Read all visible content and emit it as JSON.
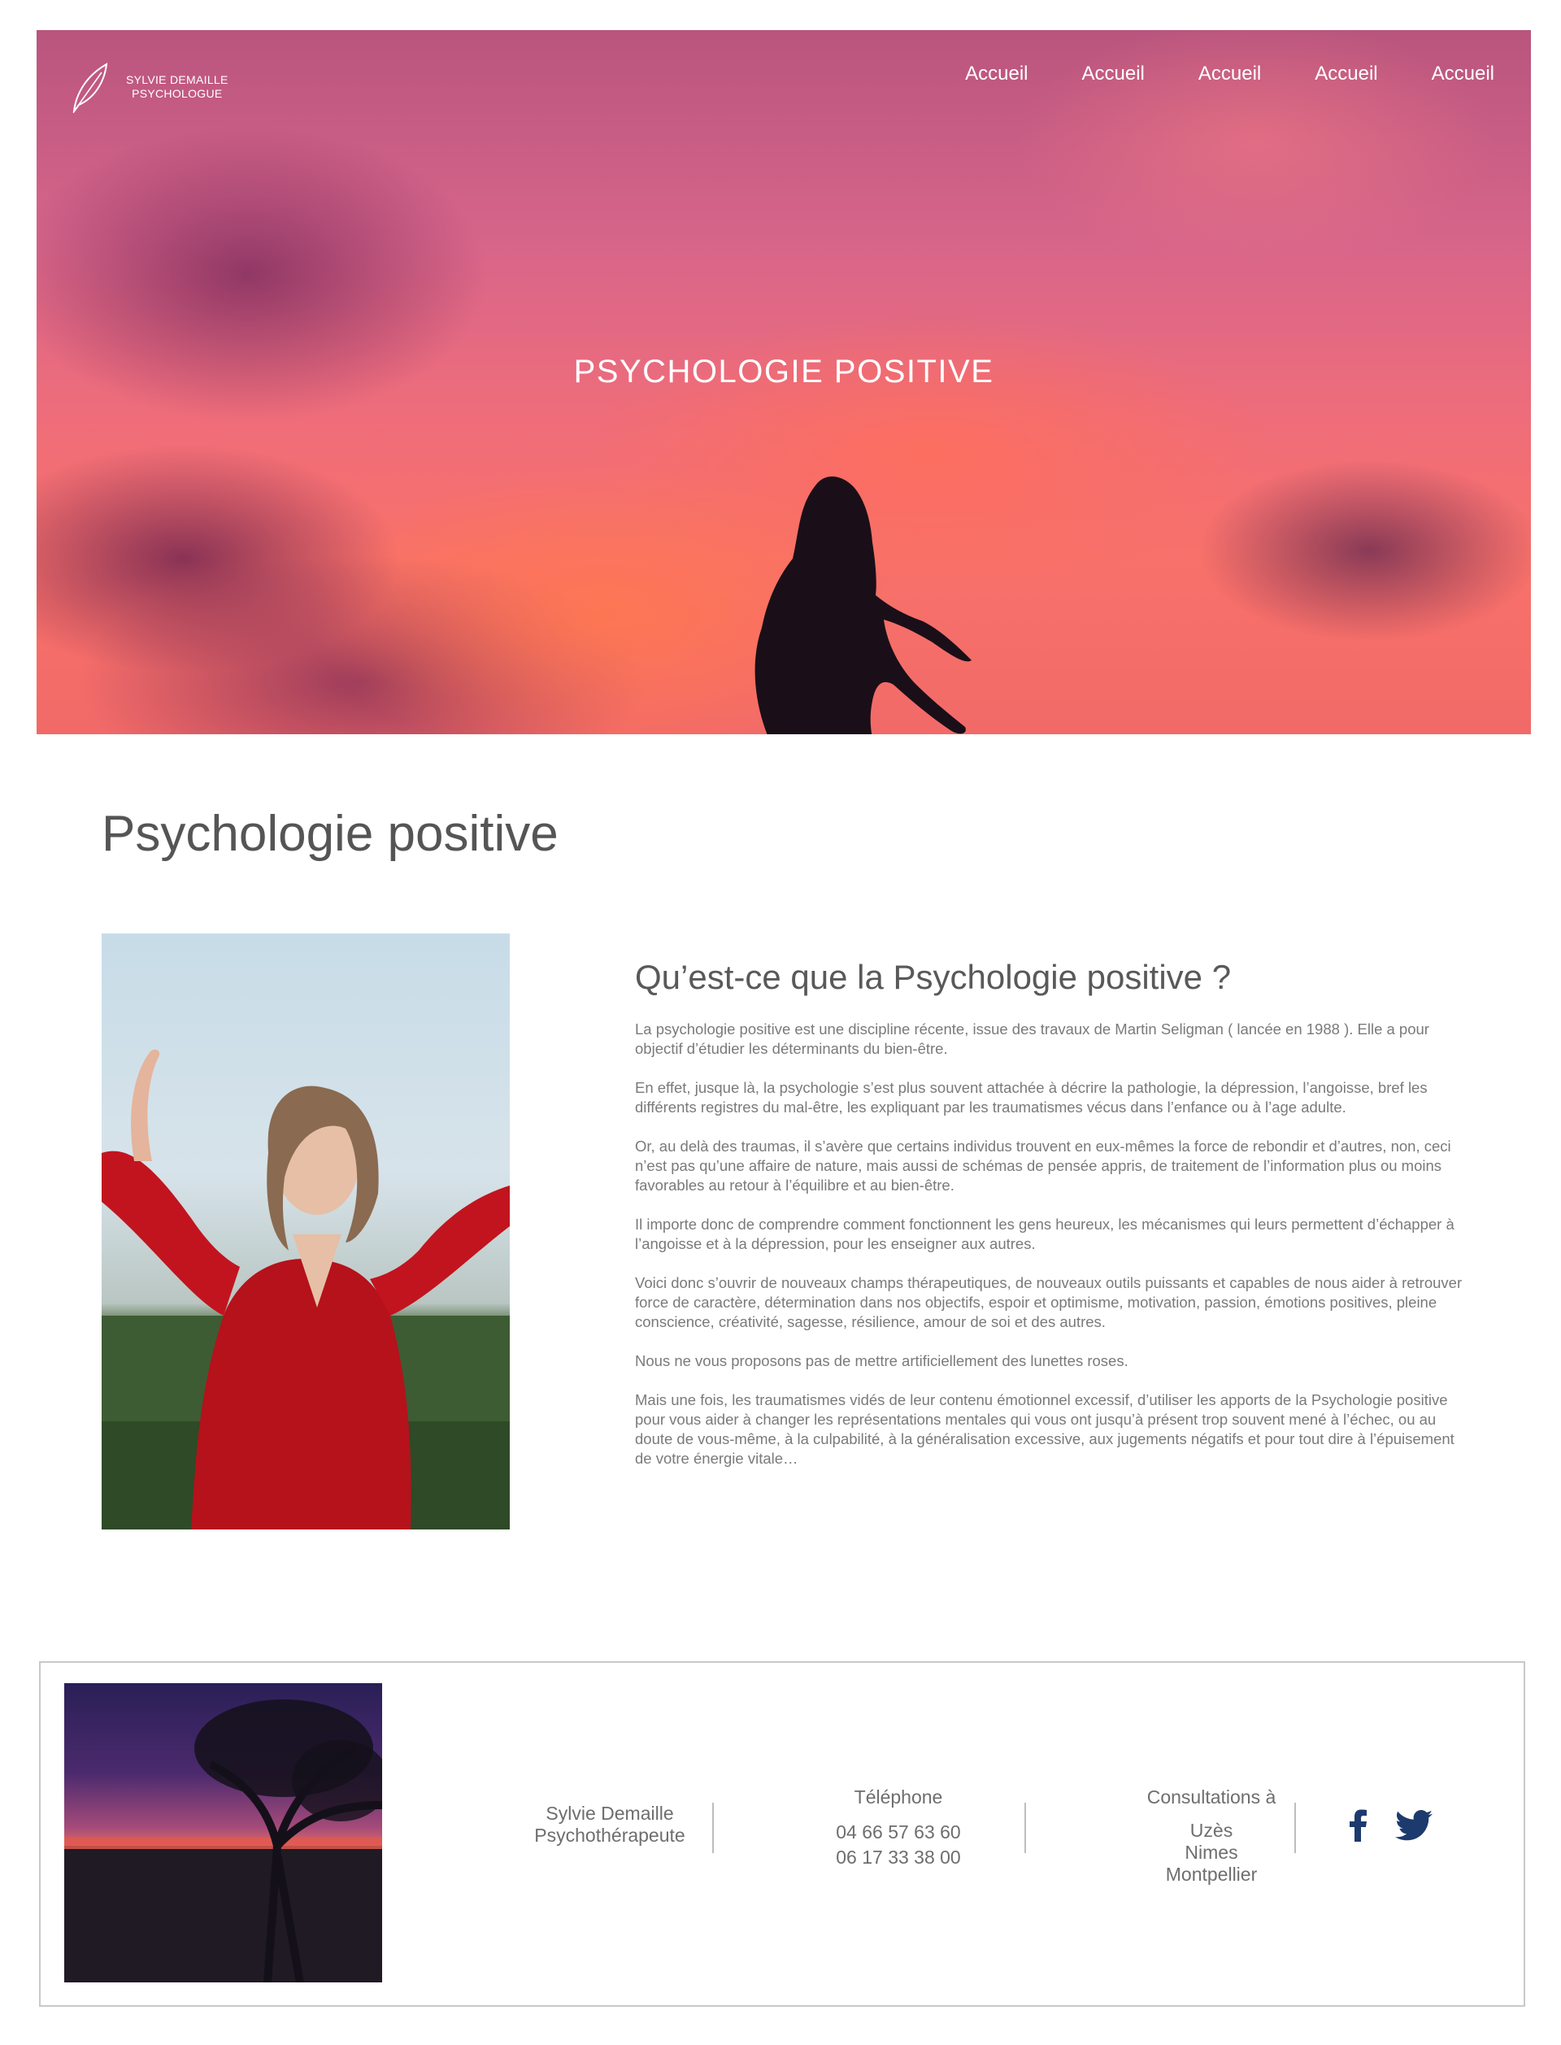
{
  "header": {
    "logo_line1": "SYLVIE DEMAILLE",
    "logo_line2": "PSYCHOLOGUE",
    "logo_icon": "feather-icon",
    "nav": [
      "Accueil",
      "Accueil",
      "Accueil",
      "Accueil",
      "Accueil"
    ],
    "hero_title": "PSYCHOLOGIE POSITIVE"
  },
  "main": {
    "title": "Psychologie positive",
    "heading": "Qu’est-ce que la Psychologie positive ?",
    "paragraphs": [
      "La psychologie positive est une discipline récente, issue des travaux de Martin Seligman ( lancée en 1988 ). Elle a pour objectif d’étudier les déterminants du bien-être.",
      "En effet, jusque là, la psychologie s’est plus souvent attachée à décrire la pathologie, la dépression, l’angoisse, bref les différents registres du mal-être, les expliquant par les traumatismes vécus dans l’enfance ou à l’age adulte.",
      "Or, au delà des traumas, il s’avère que certains individus trouvent en eux-mêmes la force de rebondir et d’autres, non, ceci n’est pas qu’une affaire de nature, mais aussi de schémas de pensée appris, de traitement de l’information plus ou moins favorables au retour à l’équilibre et au bien-être.",
      "Il importe donc de comprendre comment fonctionnent les gens heureux, les mécanismes qui leurs permettent d’échapper à l’angoisse et à la dépression, pour les enseigner aux autres.",
      "Voici donc s’ouvrir de nouveaux champs thérapeutiques, de nouveaux outils puissants et capables de nous aider à retrouver force de caractère, détermination dans nos objectifs, espoir et optimisme, motivation, passion, émotions positives, pleine conscience, créativité, sagesse, résilience, amour de soi et des autres.",
      "Nous ne vous proposons pas de mettre artificiellement des lunettes roses.",
      "Mais une fois, les traumatismes vidés de leur contenu émotionnel excessif, d’utiliser les apports de la Psychologie positive pour vous aider à changer les représentations mentales qui vous ont jusqu’à présent trop souvent mené à l’échec, ou au doute de vous-même, à la culpabilité, à la généralisation excessive, aux jugements négatifs et pour tout dire à l’épuisement de votre énergie vitale…"
    ]
  },
  "footer": {
    "name_line1": "Sylvie Demaille",
    "name_line2": "Psychothérapeute",
    "phone_title": "Téléphone",
    "phones": [
      "04 66 57 63 60",
      "06 17 33 38 00"
    ],
    "consult_title": "Consultations à",
    "cities": [
      "Uzès",
      "Nimes",
      "Montpellier"
    ],
    "social_icons": [
      "facebook-icon",
      "twitter-icon"
    ],
    "social_color": "#1c3a6e"
  }
}
